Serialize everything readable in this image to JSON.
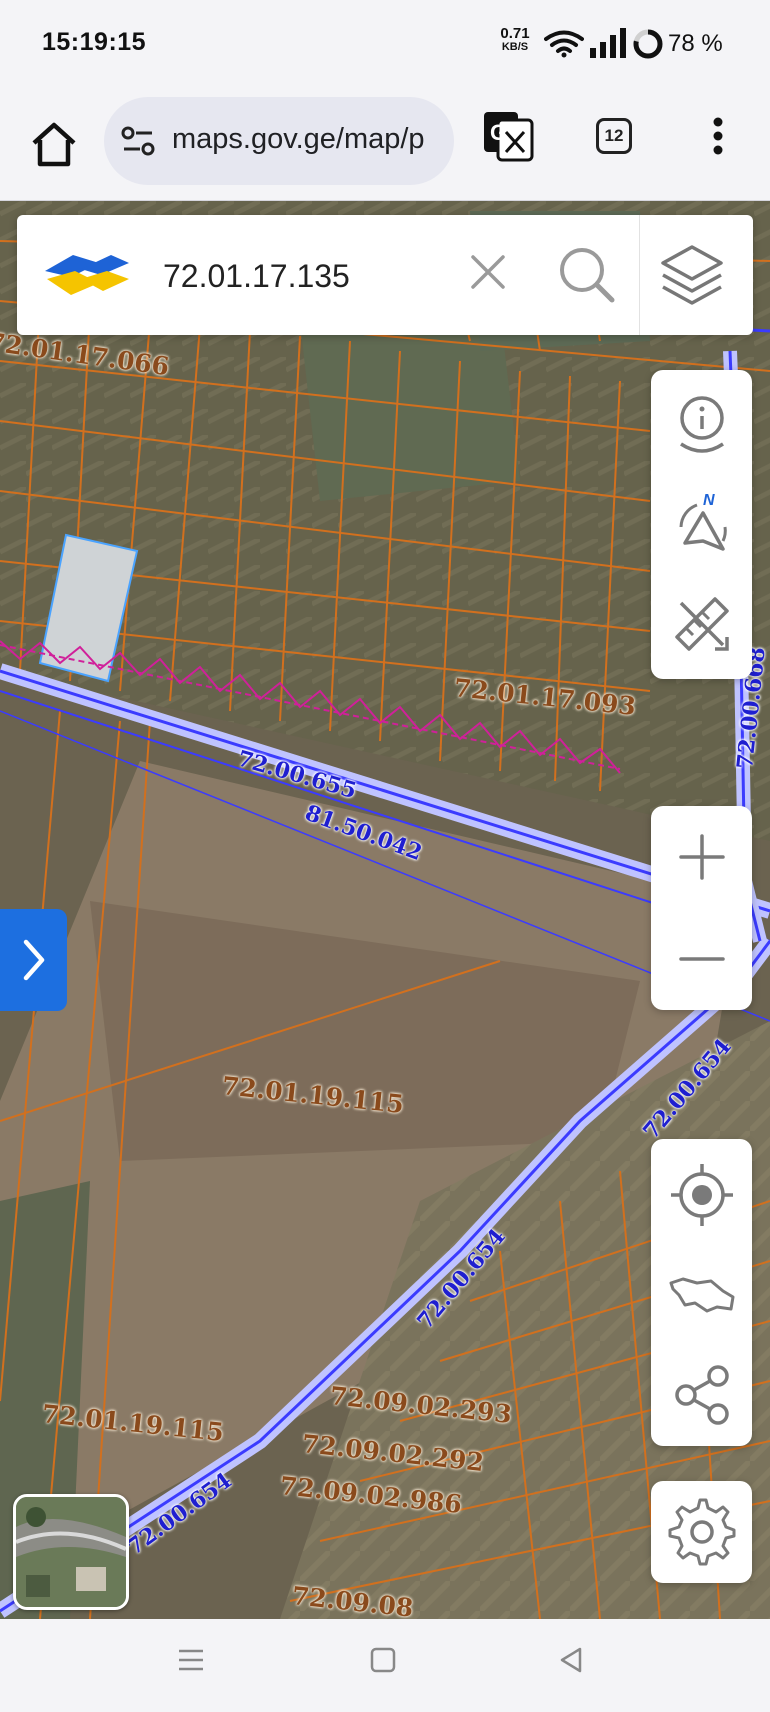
{
  "status_bar": {
    "time": "15:19:15",
    "net_speed_value": "0.71",
    "net_speed_unit": "KB/S",
    "battery": "78 %"
  },
  "browser": {
    "url": "maps.gov.ge/map/p",
    "tab_count": "12"
  },
  "search": {
    "query": "72.01.17.135"
  },
  "map": {
    "parcel_labels": [
      "72.01.17.066",
      "72.01.17.093",
      "72.01.19.115",
      "72.01.19.115",
      "72.09.02.293",
      "72.09.02.292",
      "72.09.02.986",
      "72.09.08"
    ],
    "road_labels": [
      "72.00.655",
      "81.50.042",
      "72.00.654",
      "72.00.654",
      "72.00.654",
      "72.00.668"
    ],
    "colors": {
      "parcel_line": "#d2701e",
      "road_line": "#3b3bff",
      "highlight_parcel": "#cfd3d6",
      "restriction_line": "#d0209a"
    }
  },
  "controls": {
    "side": [
      "info-icon",
      "north-compass-icon",
      "measure-icon",
      "zoom-in-icon",
      "zoom-out-icon",
      "locate-icon",
      "country-extent-icon",
      "share-icon",
      "settings-icon"
    ]
  }
}
